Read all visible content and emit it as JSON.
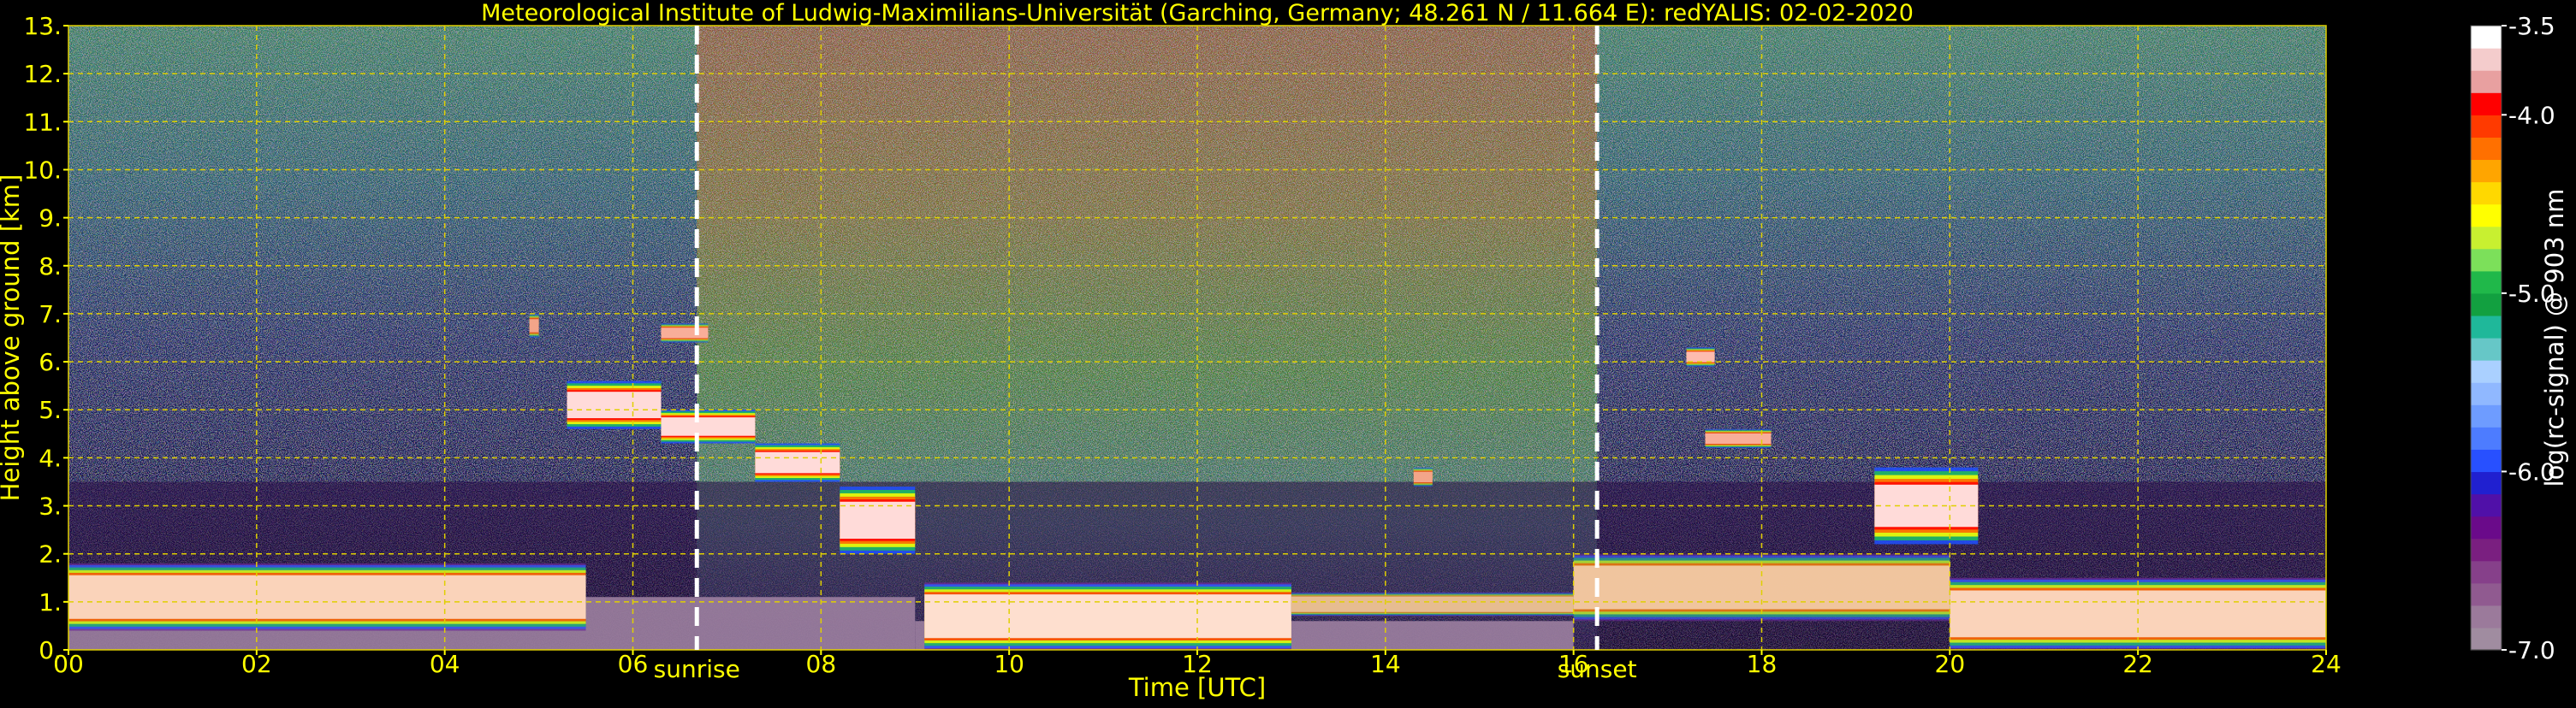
{
  "chart_data": {
    "type": "heatmap",
    "title": "Meteorological Institute of Ludwig-Maximilians-Universität (Garching, Germany; 48.261 N / 11.664 E):    redYALIS: 02-02-2020",
    "xlabel": "Time [UTC]",
    "ylabel": "Height above ground [km]",
    "xlim": [
      0,
      24
    ],
    "ylim": [
      0,
      13
    ],
    "x_ticks": [
      0,
      2,
      4,
      6,
      8,
      10,
      12,
      14,
      16,
      18,
      20,
      22,
      24
    ],
    "x_tick_labels": [
      "00",
      "02",
      "04",
      "06",
      "08",
      "10",
      "12",
      "14",
      "16",
      "18",
      "20",
      "22",
      "24"
    ],
    "y_ticks": [
      0,
      1,
      2,
      3,
      4,
      5,
      6,
      7,
      8,
      9,
      10,
      11,
      12,
      13
    ],
    "y_tick_labels": [
      "0.",
      "1.",
      "2.",
      "3.",
      "4.",
      "5.",
      "6.",
      "7.",
      "8.",
      "9.",
      "10.",
      "11.",
      "12.",
      "13."
    ],
    "grid": true,
    "colorbar": {
      "label": "log(rc-signal) @ 903 nm",
      "range": [
        -7.0,
        -3.5
      ],
      "ticks": [
        -7.0,
        -6.0,
        -5.0,
        -4.0,
        -3.5
      ],
      "tick_labels": [
        "-7.0",
        "-6.0",
        "-5.0",
        "-4.0",
        "-3.5"
      ],
      "colors": [
        "#a08ca0",
        "#9b7a9b",
        "#905a90",
        "#86408a",
        "#7a1f80",
        "#6a0a8a",
        "#5010a8",
        "#2020d0",
        "#2850ff",
        "#4d7cff",
        "#6e9cff",
        "#90b8ff",
        "#aad0ff",
        "#66c7c7",
        "#1fb89a",
        "#12a040",
        "#20b84a",
        "#7ce05a",
        "#c8f030",
        "#ffff00",
        "#ffd800",
        "#ffa500",
        "#ff7000",
        "#ff3a00",
        "#ff0000",
        "#e8a0a0",
        "#f4cccc",
        "#ffffff"
      ]
    },
    "events": [
      {
        "name": "sunrise",
        "time": 6.68
      },
      {
        "name": "sunset",
        "time": 16.25
      }
    ],
    "layers": [
      {
        "type": "boundary_layer",
        "from": 0.0,
        "to": 9.0,
        "base_km": 0.0,
        "top_km": 1.1,
        "color": "#9c80a0"
      },
      {
        "type": "boundary_layer",
        "from": 9.0,
        "to": 16.0,
        "base_km": 0.0,
        "top_km": 0.6,
        "color": "#9c80a0"
      },
      {
        "type": "aerosol",
        "from": 0.0,
        "to": 5.5,
        "base_km": 0.4,
        "top_km": 1.8,
        "intensity": 0.85
      },
      {
        "type": "aerosol",
        "from": 9.1,
        "to": 13.0,
        "base_km": 0.0,
        "top_km": 1.4,
        "intensity": 0.95
      },
      {
        "type": "aerosol",
        "from": 13.0,
        "to": 16.0,
        "base_km": 0.7,
        "top_km": 1.2,
        "intensity": 0.6
      },
      {
        "type": "aerosol",
        "from": 16.0,
        "to": 20.0,
        "base_km": 0.6,
        "top_km": 2.0,
        "intensity": 0.7
      },
      {
        "type": "aerosol",
        "from": 20.0,
        "to": 24.0,
        "base_km": 0.0,
        "top_km": 1.5,
        "intensity": 0.85
      },
      {
        "type": "cloud",
        "from": 5.3,
        "to": 6.3,
        "base_km": 4.6,
        "top_km": 5.6,
        "intensity": 1.0
      },
      {
        "type": "cloud",
        "from": 6.3,
        "to": 7.3,
        "base_km": 4.3,
        "top_km": 5.0,
        "intensity": 1.0
      },
      {
        "type": "cloud",
        "from": 7.3,
        "to": 8.2,
        "base_km": 3.5,
        "top_km": 4.3,
        "intensity": 1.0
      },
      {
        "type": "cloud",
        "from": 8.2,
        "to": 9.0,
        "base_km": 2.0,
        "top_km": 3.4,
        "intensity": 1.0
      },
      {
        "type": "cloud",
        "from": 19.2,
        "to": 20.3,
        "base_km": 2.2,
        "top_km": 3.8,
        "intensity": 1.0
      },
      {
        "type": "cloud",
        "from": 17.2,
        "to": 17.5,
        "base_km": 5.9,
        "top_km": 6.3,
        "intensity": 0.8
      },
      {
        "type": "cloud",
        "from": 17.4,
        "to": 18.1,
        "base_km": 4.2,
        "top_km": 4.6,
        "intensity": 0.7
      },
      {
        "type": "cloud",
        "from": 14.3,
        "to": 14.5,
        "base_km": 3.4,
        "top_km": 3.8,
        "intensity": 0.6
      },
      {
        "type": "cloud",
        "from": 6.3,
        "to": 6.8,
        "base_km": 6.4,
        "top_km": 6.8,
        "intensity": 0.7
      },
      {
        "type": "cloud",
        "from": 4.9,
        "to": 5.0,
        "base_km": 6.5,
        "top_km": 7.0,
        "intensity": 0.6
      }
    ]
  }
}
